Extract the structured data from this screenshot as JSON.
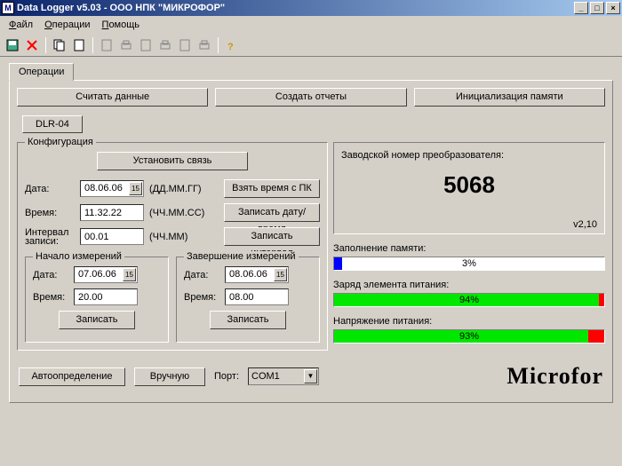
{
  "window": {
    "title": "Data Logger v5.03   -   ООО НПК \"МИКРОФОР\"",
    "min": "_",
    "max": "□",
    "close": "×"
  },
  "menu": {
    "file": "айл",
    "file_u": "Ф",
    "ops": "перации",
    "ops_u": "О",
    "help": "омощь",
    "help_u": "П"
  },
  "tab": "Операции",
  "buttons": {
    "read": "Считать данные",
    "reports": "Создать отчеты",
    "init": "Инициализация памяти"
  },
  "device": "DLR-04",
  "config": {
    "legend": "Конфигурация",
    "connect": "Установить связь",
    "date_lbl": "Дата:",
    "date_val": "08.06.06",
    "date_hint": "(ДД.ММ.ГГ)",
    "take_time": "Взять время с ПК",
    "time_lbl": "Время:",
    "time_val": "11.32.22",
    "time_hint": "(ЧЧ.ММ.СС)",
    "write_dt": "Записать дату/время",
    "int_lbl": "Интервал",
    "int_lbl2": "записи:",
    "int_val": "00.01",
    "int_hint": "(ЧЧ.ММ)",
    "write_int": "Записать интервал",
    "start": {
      "legend": "Начало измерений",
      "date_lbl": "Дата:",
      "date_val": "07.06.06",
      "time_lbl": "Время:",
      "time_val": "20.00",
      "write": "Записать"
    },
    "end": {
      "legend": "Завершение измерений",
      "date_lbl": "Дата:",
      "date_val": "08.06.06",
      "time_lbl": "Время:",
      "time_val": "08.00",
      "write": "Записать"
    }
  },
  "serial": {
    "legend": "Заводской номер преобразователя:",
    "value": "5068",
    "ver": "v2,10"
  },
  "progress": {
    "mem_lbl": "Заполнение памяти:",
    "mem_pct": 3,
    "mem_txt": "3%",
    "bat_lbl": "Заряд элемента питания:",
    "bat_pct": 94,
    "bat_txt": "94%",
    "volt_lbl": "Напряжение питания:",
    "volt_pct": 93,
    "volt_txt": "93%"
  },
  "bottom": {
    "auto": "Автоопределение",
    "manual": "Вручную",
    "port_lbl": "Порт:",
    "port_val": "COM1"
  },
  "brand": "Microfor"
}
